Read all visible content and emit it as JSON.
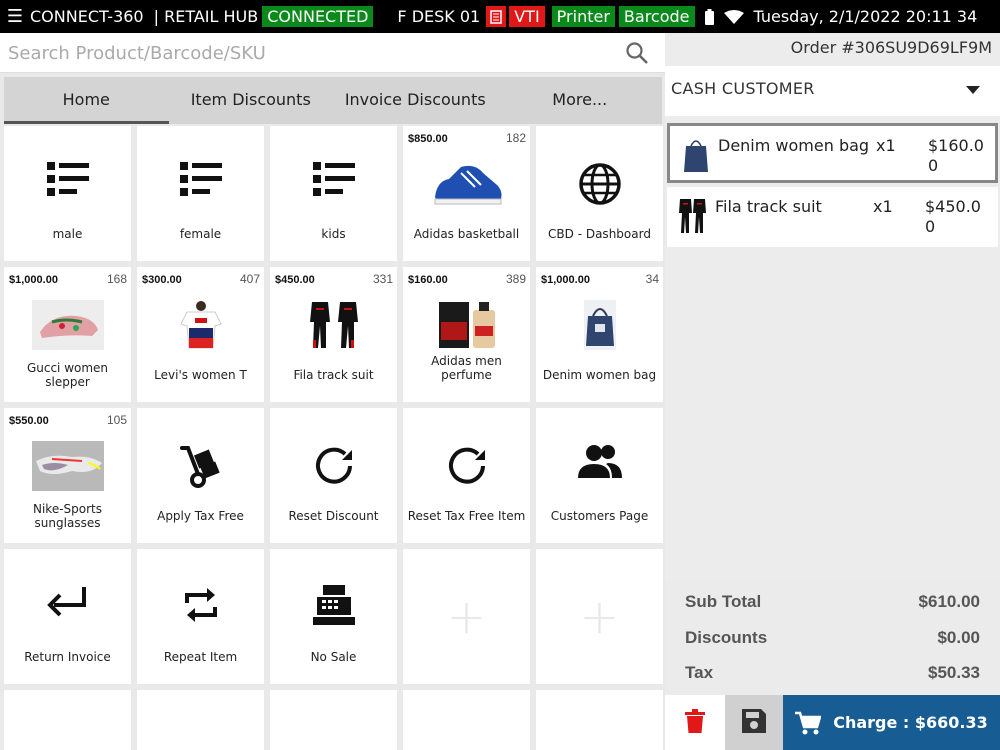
{
  "statusbar": {
    "app_name": "CONNECT-360",
    "hub_label": "| RETAIL HUB",
    "connection_status": "CONNECTED",
    "desk": "F DESK 01",
    "vti_badge": "VTI",
    "printer_badge": "Printer",
    "barcode_badge": "Barcode",
    "datetime": "Tuesday, 2/1/2022 20:11 34"
  },
  "search": {
    "placeholder": "Search Product/Barcode/SKU",
    "value": ""
  },
  "tabs": [
    {
      "label": "Home",
      "active": true
    },
    {
      "label": "Item Discounts",
      "active": false
    },
    {
      "label": "Invoice Discounts",
      "active": false
    },
    {
      "label": "More...",
      "active": false
    }
  ],
  "tiles": {
    "row1": [
      {
        "label": "male",
        "icon": "list-icon"
      },
      {
        "label": "female",
        "icon": "list-icon"
      },
      {
        "label": "kids",
        "icon": "list-icon"
      },
      {
        "label": "Adidas basketball",
        "price": "$850.00",
        "stock": "182",
        "image": "basketball-shoe-image"
      },
      {
        "label": "CBD - Dashboard",
        "icon": "globe-icon"
      }
    ],
    "row2": [
      {
        "label": "Gucci women slepper",
        "price": "$1,000.00",
        "stock": "168",
        "image": "slipper-image"
      },
      {
        "label": "Levi's women T",
        "price": "$300.00",
        "stock": "407",
        "image": "tshirt-image"
      },
      {
        "label": "Fila track suit",
        "price": "$450.00",
        "stock": "331",
        "image": "tracksuit-image"
      },
      {
        "label": "Adidas men perfume",
        "price": "$160.00",
        "stock": "389",
        "image": "perfume-image"
      },
      {
        "label": "Denim women bag",
        "price": "$1,000.00",
        "stock": "34",
        "image": "bag-image"
      }
    ],
    "row3": [
      {
        "label": "Nike-Sports sunglasses",
        "price": "$550.00",
        "stock": "105",
        "image": "sunglasses-image"
      },
      {
        "label": "Apply Tax Free",
        "icon": "hand-truck-icon"
      },
      {
        "label": "Reset Discount",
        "icon": "refresh-icon"
      },
      {
        "label": "Reset Tax Free Item",
        "icon": "refresh-icon"
      },
      {
        "label": "Customers Page",
        "icon": "people-icon"
      }
    ],
    "row4": [
      {
        "label": "Return Invoice",
        "icon": "return-arrow-icon"
      },
      {
        "label": "Repeat Item",
        "icon": "repeat-icon"
      },
      {
        "label": "No Sale",
        "icon": "cash-register-icon"
      },
      {
        "label": "",
        "icon": "plus-icon"
      },
      {
        "label": "",
        "icon": "plus-icon"
      }
    ]
  },
  "order": {
    "number": "Order #306SU9D69LF9M",
    "customer": "CASH CUSTOMER",
    "items": [
      {
        "name": "Denim women bag",
        "qty": "x1",
        "amount": "$160.00",
        "selected": true
      },
      {
        "name": "Fila track suit",
        "qty": "x1",
        "amount": "$450.00",
        "selected": false
      }
    ],
    "totals": {
      "subtotal_label": "Sub Total",
      "subtotal": "$610.00",
      "discounts_label": "Discounts",
      "discounts": "$0.00",
      "tax_label": "Tax",
      "tax": "$50.33"
    },
    "charge_label": "Charge : $660.33"
  },
  "colors": {
    "accent": "#175d94",
    "connected": "#0b8a1c",
    "alert": "#e01818",
    "delete": "#e01818"
  }
}
